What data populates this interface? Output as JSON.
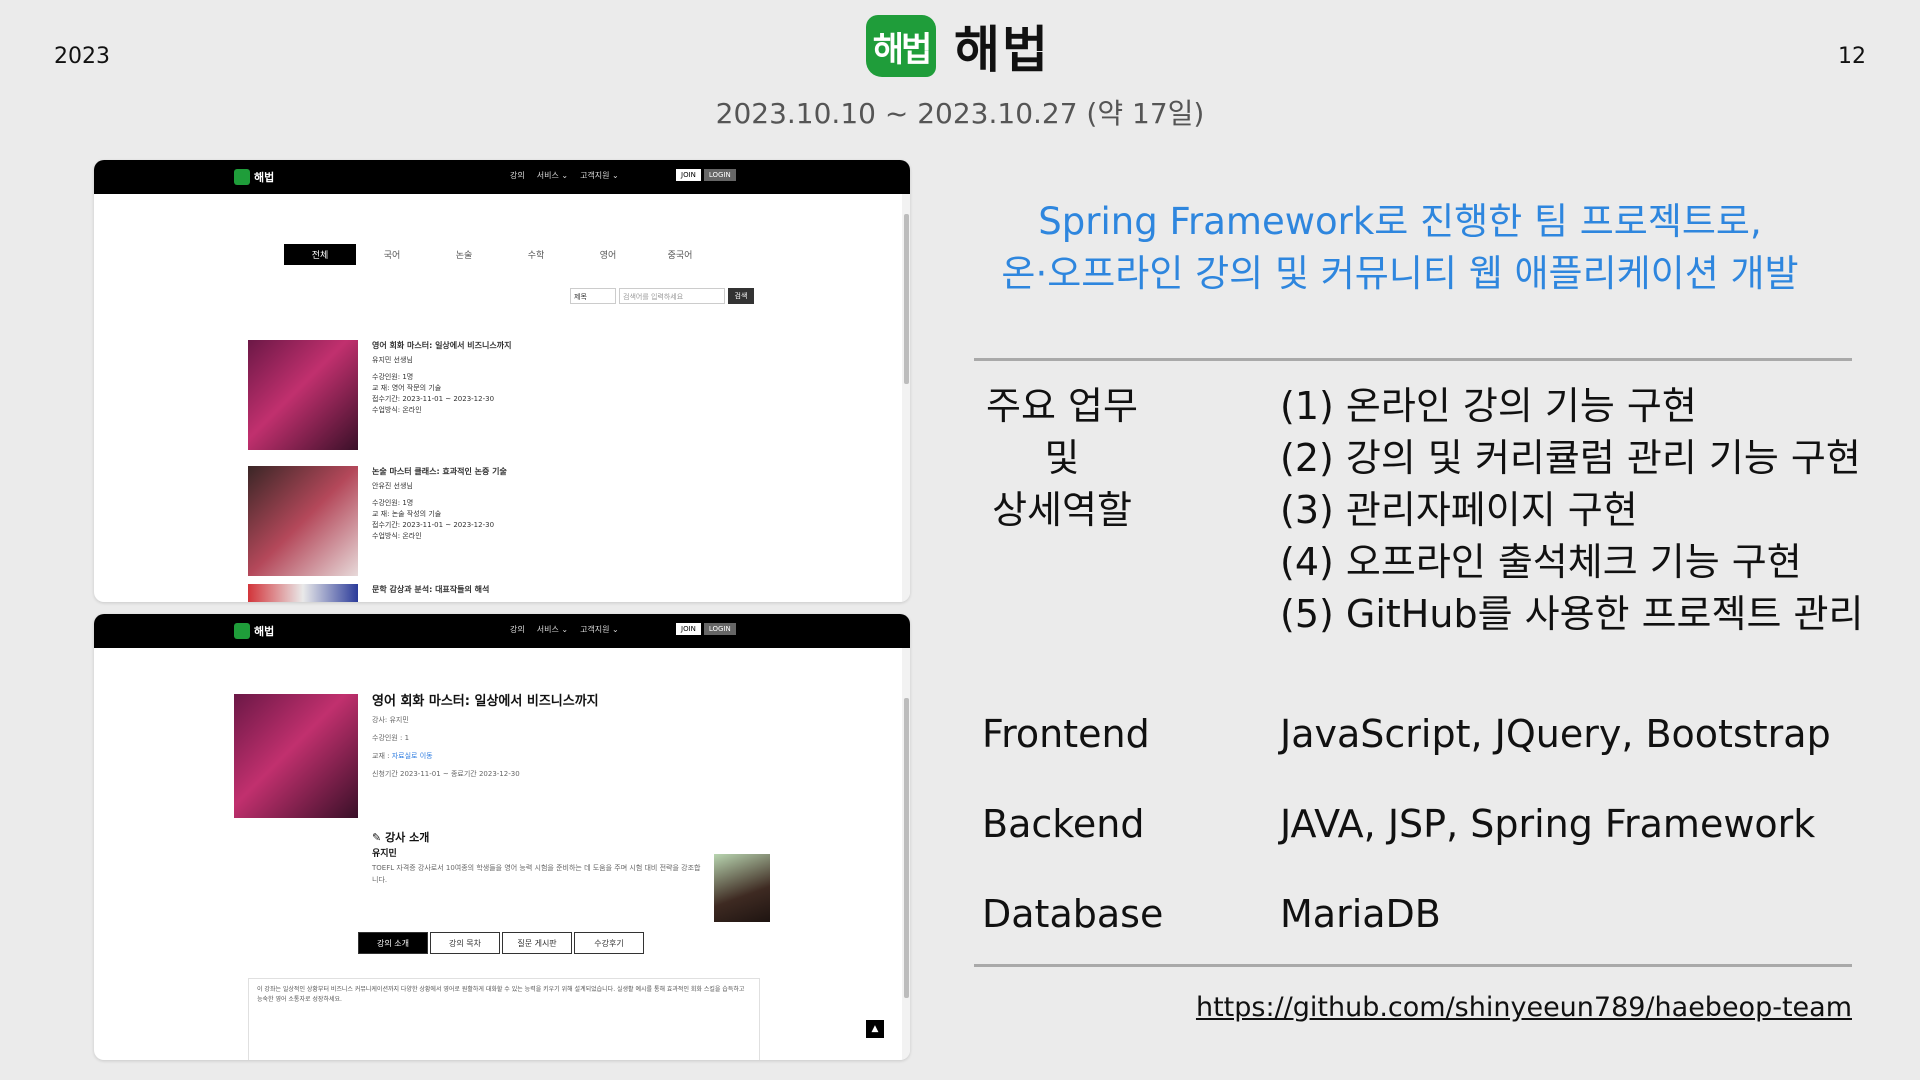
{
  "slide": {
    "year": "2023",
    "page_number": "12",
    "brand_name": "해법",
    "logo_text": "해법",
    "period": "2023.10.10 ~ 2023.10.27 (약 17일)",
    "headline_line1": "Spring Framework로 진행한 팀 프로젝트로,",
    "headline_line2": "온·오프라인 강의 및 커뮤니티 웹 애플리케이션 개발",
    "roles_label": [
      "주요 업무",
      "및",
      "상세역할"
    ],
    "tasks": [
      "(1) 온라인 강의 기능 구현",
      "(2) 강의 및 커리큘럼 관리 기능 구현",
      "(3) 관리자페이지 구현",
      "(4) 오프라인 출석체크 기능 구현",
      "(5) GitHub를 사용한 프로젝트 관리"
    ],
    "stack": [
      {
        "label": "Frontend",
        "value": "JavaScript, JQuery, Bootstrap"
      },
      {
        "label": "Backend",
        "value": "JAVA, JSP, Spring Framework"
      },
      {
        "label": "Database",
        "value": "MariaDB"
      }
    ],
    "github_url": "https://github.com/shinyeeun789/haebeop-team",
    "headline_color": "#2e86de",
    "logo_color": "#1f9d3a"
  },
  "screenshot_nav": {
    "logo": "해법",
    "menu": [
      "강의",
      "서비스 ⌄",
      "고객지원 ⌄"
    ],
    "join": "JOIN",
    "login": "LOGIN"
  },
  "list_page": {
    "tabs": [
      "전체",
      "국어",
      "논술",
      "수학",
      "영어",
      "중국어"
    ],
    "search_select": "제목",
    "search_placeholder": "검색어를 입력하세요",
    "search_button": "검색",
    "courses": [
      {
        "title": "영어 회화 마스터: 일상에서 비즈니스까지",
        "teacher": "유지민 선생님",
        "enrolled": "수강인원: 1명",
        "textbook": "교      재: 영어 작문의 기술",
        "period": "접수기간: 2023-11-01 ~ 2023-12-30",
        "mode": "수업방식: 온라인"
      },
      {
        "title": "논술 마스터 클래스: 효과적인 논증 기술",
        "teacher": "안유진 선생님",
        "enrolled": "수강인원: 1명",
        "textbook": "교      재: 논술 작성의 기술",
        "period": "접수기간: 2023-11-01 ~ 2023-12-30",
        "mode": "수업방식: 온라인"
      },
      {
        "title": "문학 감상과 분석: 대표작들의 해석"
      }
    ]
  },
  "detail_page": {
    "title": "영어 회화 마스터: 일상에서 비즈니스까지",
    "teacher": "강사: 유지민",
    "enrolled": "수강인원 : 1",
    "textbook_label": "교재 :",
    "textbook_link": "자료실로 이동",
    "period": "신청기간 2023-11-01 ~ 종료기간 2023-12-30",
    "instructor_heading": "강사 소개",
    "instructor_name": "유지민",
    "instructor_bio": "TOEFL 자격증 강사로서 10여종의 학생들을 영어 능력 시험을 준비하는 데 도움을 주며 시험 대비 전략을 강조합니다.",
    "tabs": [
      "강의 소개",
      "강의 목차",
      "질문 게시판",
      "수강후기"
    ],
    "description": "이 강좌는 일상적인 상황부터 비즈니스 커뮤니케이션까지 다양한 상황에서 영어로 원활하게 대화할 수 있는 능력을 키우기 위해 설계되었습니다. 실생활 예시를 통해 효과적인 회화 스킬을 습득하고 능숙한 영어 소통자로 성장하세요.",
    "to_top": "▲"
  }
}
